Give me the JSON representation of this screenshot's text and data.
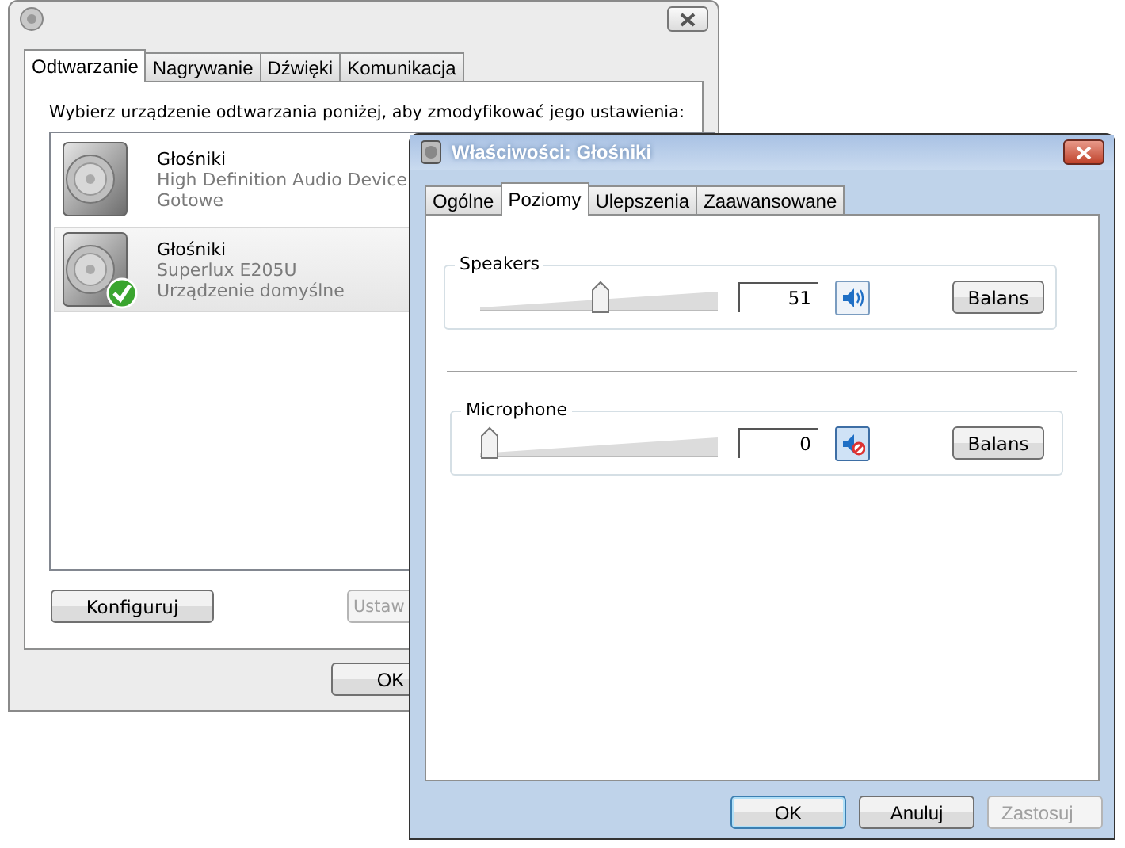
{
  "back_window": {
    "tabs": [
      {
        "label": "Odtwarzanie",
        "selected": true
      },
      {
        "label": "Nagrywanie",
        "selected": false
      },
      {
        "label": "Dźwięki",
        "selected": false
      },
      {
        "label": "Komunikacja",
        "selected": false
      }
    ],
    "instruction": "Wybierz urządzenie odtwarzania poniżej, aby zmodyfikować jego ustawienia:",
    "devices": [
      {
        "name": "Głośniki",
        "model": "High Definition Audio Device",
        "status": "Gotowe",
        "selected": false,
        "default": false
      },
      {
        "name": "Głośniki",
        "model": "Superlux E205U",
        "status": "Urządzenie domyślne",
        "selected": true,
        "default": true
      }
    ],
    "buttons": [
      {
        "label": "Konfiguruj",
        "disabled": false
      },
      {
        "label": "Ustaw",
        "disabled": true
      }
    ],
    "footer_buttons": [
      {
        "label": "OK"
      }
    ]
  },
  "front_window": {
    "title": "Właściwości: Głośniki",
    "tabs": [
      {
        "label": "Ogólne",
        "selected": false
      },
      {
        "label": "Poziomy",
        "selected": true
      },
      {
        "label": "Ulepszenia",
        "selected": false
      },
      {
        "label": "Zaawansowane",
        "selected": false
      }
    ],
    "levels": [
      {
        "label": "Speakers",
        "level": 0.51,
        "value": "51",
        "muted": false,
        "button": "Balans"
      },
      {
        "label": "Microphone",
        "level": 0,
        "value": "0",
        "muted": true,
        "button": "Balans"
      }
    ],
    "buttons": [
      {
        "label": "OK",
        "default": true,
        "disabled": false
      },
      {
        "label": "Anuluj",
        "default": false,
        "disabled": false
      },
      {
        "label": "Zastosuj",
        "default": false,
        "disabled": true
      }
    ]
  }
}
